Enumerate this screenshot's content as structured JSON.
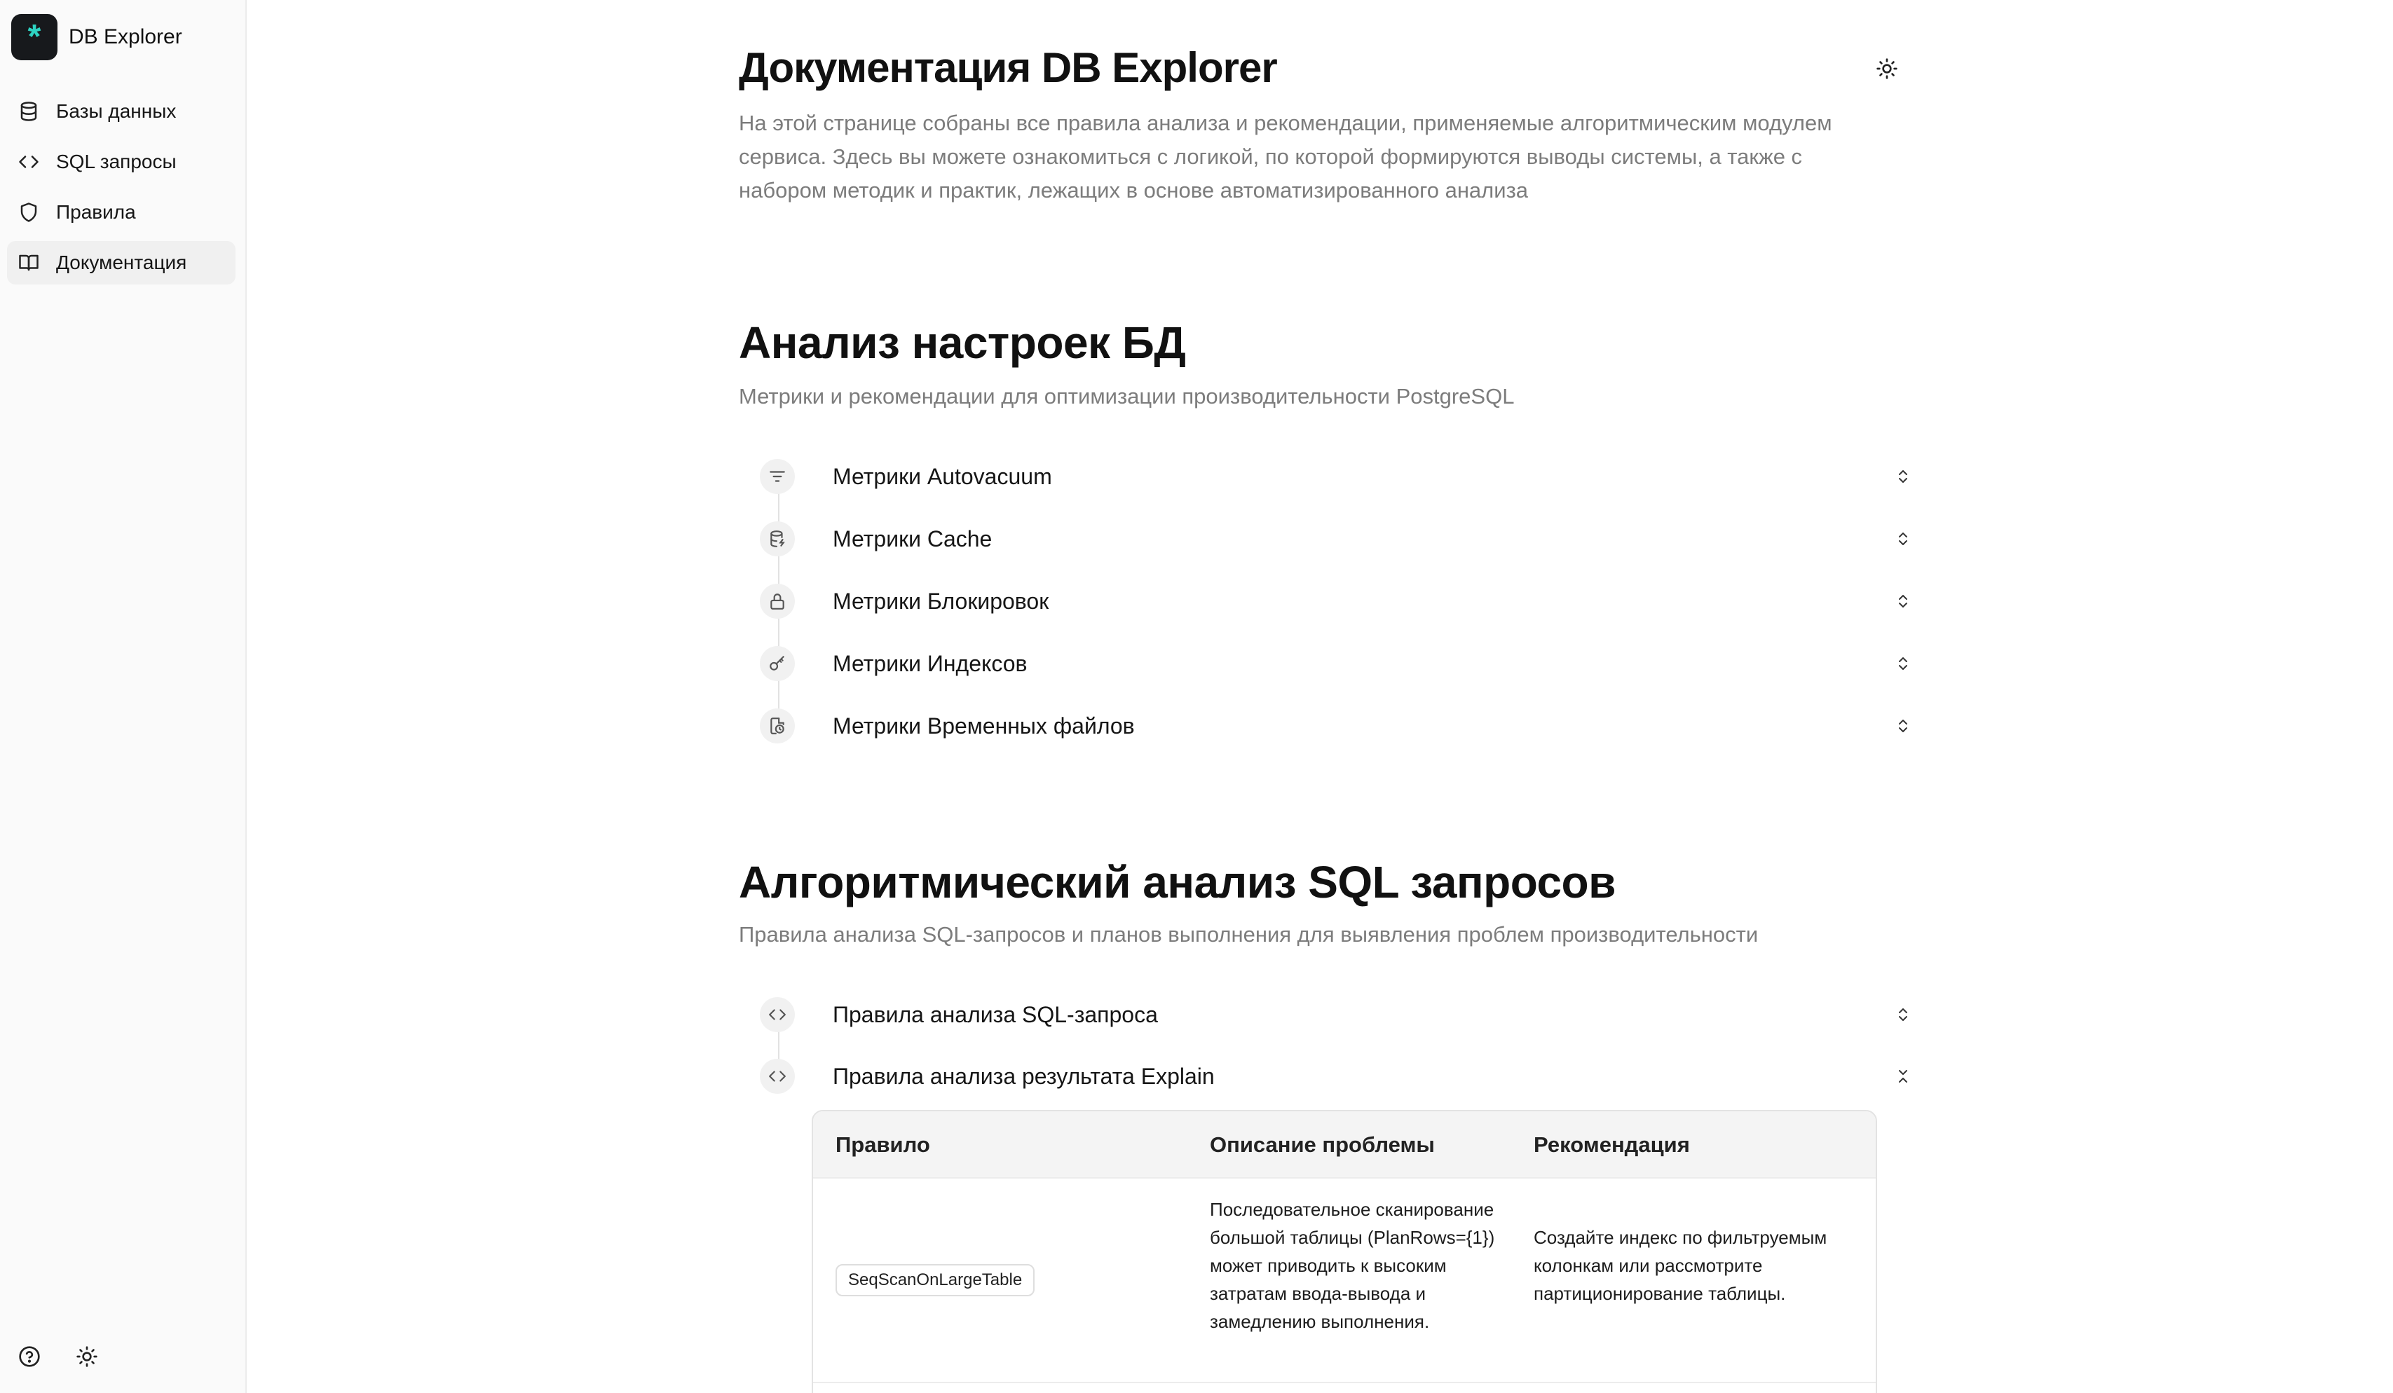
{
  "app": {
    "name": "DB Explorer"
  },
  "sidebar": {
    "items": [
      {
        "label": "Базы данных",
        "icon": "database-icon"
      },
      {
        "label": "SQL запросы",
        "icon": "code-icon"
      },
      {
        "label": "Правила",
        "icon": "shield-icon"
      },
      {
        "label": "Документация",
        "icon": "book-icon",
        "active": true
      }
    ],
    "bottom_icons": [
      "help-icon",
      "sun-icon"
    ]
  },
  "page": {
    "title": "Документация DB Explorer",
    "description": "На этой странице собраны все правила анализа и рекомендации, применяемые алгоритмическим модулем сервиса. Здесь вы можете ознакомиться с логикой, по которой формируются выводы системы, а также с набором методик и практик, лежащих в основе автоматизированного анализа"
  },
  "sections": [
    {
      "title": "Анализ настроек БД",
      "subtitle": "Метрики и рекомендации для оптимизации производительности PostgreSQL",
      "items": [
        {
          "label": "Метрики Autovacuum",
          "icon": "filter-icon",
          "expanded": false
        },
        {
          "label": "Метрики Cache",
          "icon": "database-zap-icon",
          "expanded": false
        },
        {
          "label": "Метрики Блокировок",
          "icon": "lock-icon",
          "expanded": false
        },
        {
          "label": "Метрики Индексов",
          "icon": "key-icon",
          "expanded": false
        },
        {
          "label": "Метрики Временных файлов",
          "icon": "file-clock-icon",
          "expanded": false
        }
      ]
    },
    {
      "title": "Алгоритмический анализ SQL запросов",
      "subtitle": "Правила анализа SQL-запросов и планов выполнения для выявления проблем производительности",
      "items": [
        {
          "label": "Правила анализа SQL-запроса",
          "icon": "code-icon",
          "expanded": false
        },
        {
          "label": "Правила анализа результата Explain",
          "icon": "code-icon",
          "expanded": true
        }
      ]
    }
  ],
  "explain_table": {
    "headers": {
      "rule": "Правило",
      "problem": "Описание проблемы",
      "recommendation": "Рекомендация"
    },
    "rows": [
      {
        "rule": "SeqScanOnLargeTable",
        "problem": "Последовательное сканирование большой таблицы (PlanRows={1}) может приводить к высоким затратам ввода-вывода и замедлению выполнения.",
        "recommendation": "Создайте индекс по фильтруемым колонкам или рассмотрите партиционирование таблицы."
      }
    ]
  },
  "colors": {
    "brand_bg": "#17191c",
    "brand_accent": "#2ed3c2",
    "muted_text": "#7c7c7c",
    "active_nav_bg": "#f0f0f0"
  }
}
